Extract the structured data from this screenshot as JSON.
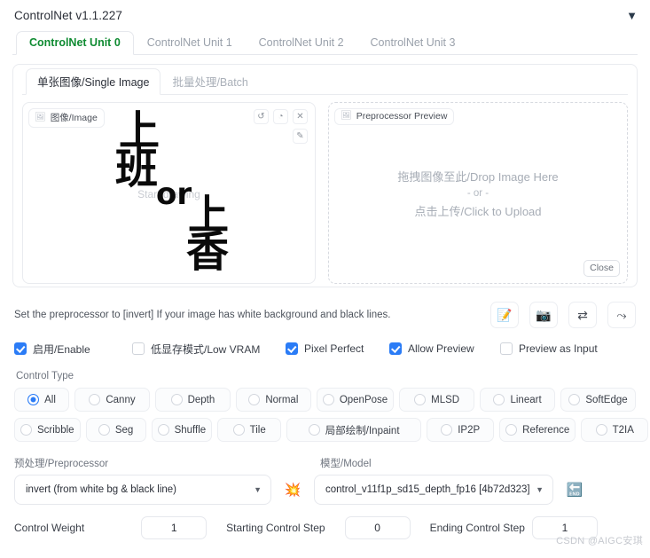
{
  "header": {
    "title": "ControlNet v1.1.227",
    "caret_icon": "▼"
  },
  "tabs": [
    {
      "label": "ControlNet Unit 0",
      "active": true
    },
    {
      "label": "ControlNet Unit 1",
      "active": false
    },
    {
      "label": "ControlNet Unit 2",
      "active": false
    },
    {
      "label": "ControlNet Unit 3",
      "active": false
    }
  ],
  "subtabs": [
    {
      "label": "单张图像/Single Image",
      "active": true
    },
    {
      "label": "批量处理/Batch",
      "active": false
    }
  ],
  "image_pane": {
    "chip_label": "图像/Image",
    "chip_icon": "image-icon",
    "tools": [
      {
        "name": "undo-icon",
        "glyph": "↺"
      },
      {
        "name": "eraser-icon",
        "glyph": "◔"
      },
      {
        "name": "close-icon",
        "glyph": "✕"
      },
      {
        "name": "brush-icon",
        "glyph": "✎"
      }
    ],
    "placeholder_hint": "Start drawing",
    "artwork": {
      "line1": "上",
      "line2": "班",
      "connector": "or",
      "line3": "上",
      "line4": "香"
    }
  },
  "preview_pane": {
    "chip_label": "Preprocessor Preview",
    "chip_icon": "image-icon",
    "drop_line1": "拖拽图像至此/Drop Image Here",
    "drop_line2": "- or -",
    "drop_line3": "点击上传/Click to Upload",
    "close_label": "Close"
  },
  "hint": {
    "text": "Set the preprocessor to [invert] If your image has white background and black lines.",
    "buttons": [
      {
        "name": "memo-icon",
        "glyph": "📝"
      },
      {
        "name": "camera-icon",
        "glyph": "📷"
      },
      {
        "name": "swap-arrows-icon",
        "glyph": "⇄"
      },
      {
        "name": "arrow-up-right-icon",
        "glyph": "⤳"
      }
    ]
  },
  "checkboxes": [
    {
      "label": "启用/Enable",
      "checked": true
    },
    {
      "label": "低显存模式/Low VRAM",
      "checked": false
    },
    {
      "label": "Pixel Perfect",
      "checked": true
    },
    {
      "label": "Allow Preview",
      "checked": true
    },
    {
      "label": "Preview as Input",
      "checked": false
    }
  ],
  "control_type": {
    "label": "Control Type",
    "row1": [
      {
        "label": "All",
        "selected": true
      },
      {
        "label": "Canny",
        "selected": false
      },
      {
        "label": "Depth",
        "selected": false
      },
      {
        "label": "Normal",
        "selected": false
      },
      {
        "label": "OpenPose",
        "selected": false
      },
      {
        "label": "MLSD",
        "selected": false
      },
      {
        "label": "Lineart",
        "selected": false
      },
      {
        "label": "SoftEdge",
        "selected": false
      }
    ],
    "row2": [
      {
        "label": "Scribble",
        "selected": false
      },
      {
        "label": "Seg",
        "selected": false
      },
      {
        "label": "Shuffle",
        "selected": false
      },
      {
        "label": "Tile",
        "selected": false
      },
      {
        "label": "局部绘制/Inpaint",
        "selected": false
      },
      {
        "label": "IP2P",
        "selected": false
      },
      {
        "label": "Reference",
        "selected": false
      },
      {
        "label": "T2IA",
        "selected": false
      }
    ]
  },
  "preprocessor": {
    "label": "预处理/Preprocessor",
    "value": "invert (from white bg & black line)",
    "caret": "▼",
    "action_icon": "sparkle-burst-icon",
    "action_glyph": "💥"
  },
  "model": {
    "label": "模型/Model",
    "value": "control_v11f1p_sd15_depth_fp16 [4b72d323]",
    "caret": "▼",
    "action_icon": "end-arrow-icon",
    "action_glyph": "🔚"
  },
  "sliders": [
    {
      "label": "Control Weight",
      "value": "1"
    },
    {
      "label": "Starting Control Step",
      "value": "0"
    },
    {
      "label": "Ending Control Step",
      "value": "1"
    }
  ],
  "watermark": "CSDN @AIGC安琪",
  "colors": {
    "active_tab": "#0f8b32",
    "checkbox_on": "#2b7cf6",
    "radio_on": "#2b7cf6",
    "border": "#e6e8ed",
    "text": "#2b2f38",
    "muted": "#9aa1ab"
  }
}
